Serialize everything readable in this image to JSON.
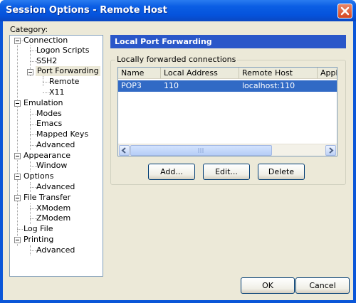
{
  "window": {
    "title": "Session Options - Remote Host"
  },
  "sidebar": {
    "label": "Category:",
    "items": [
      {
        "label": "Connection"
      },
      {
        "label": "Logon Scripts"
      },
      {
        "label": "SSH2"
      },
      {
        "label": "Port Forwarding",
        "selected": true
      },
      {
        "label": "Remote"
      },
      {
        "label": "X11"
      },
      {
        "label": "Emulation"
      },
      {
        "label": "Modes"
      },
      {
        "label": "Emacs"
      },
      {
        "label": "Mapped Keys"
      },
      {
        "label": "Advanced"
      },
      {
        "label": "Appearance"
      },
      {
        "label": "Window"
      },
      {
        "label": "Options"
      },
      {
        "label": "Advanced"
      },
      {
        "label": "File Transfer"
      },
      {
        "label": "XModem"
      },
      {
        "label": "ZModem"
      },
      {
        "label": "Log File"
      },
      {
        "label": "Printing"
      },
      {
        "label": "Advanced"
      }
    ]
  },
  "panel": {
    "header": "Local Port Forwarding",
    "group_label": "Locally forwarded connections",
    "columns": [
      "Name",
      "Local Address",
      "Remote Host",
      "Appli"
    ],
    "rows": [
      {
        "name": "POP3",
        "local_address": "110",
        "remote_host": "localhost:110",
        "selected": true
      }
    ],
    "buttons": {
      "add": "Add...",
      "edit": "Edit...",
      "delete": "Delete"
    }
  },
  "footer": {
    "ok": "OK",
    "cancel": "Cancel"
  },
  "icons": [
    "close-icon",
    "scroll-left-arrow-icon",
    "scroll-right-arrow-icon",
    "scroll-grip-icon",
    "tree-collapse-icon"
  ],
  "colors": {
    "titlebar": "#0553dc",
    "panel_header": "#2a57c9",
    "selection": "#316ac5",
    "dialog_bg": "#ece9d8",
    "close_button": "#d7461f"
  }
}
